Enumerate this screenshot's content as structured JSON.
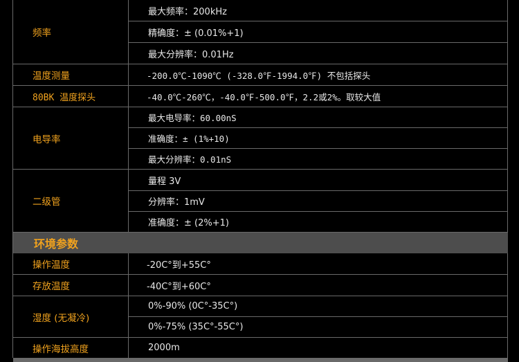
{
  "specs": {
    "frequency": {
      "label": "频率",
      "items": [
        "最大频率：200kHz",
        "精确度：± (0.01%+1)",
        "最大分辨率：0.01Hz"
      ]
    },
    "temperature": {
      "label": "温度测量",
      "value": "-200.0℃-1090℃ (-328.0℉-1994.0℉) 不包括探头"
    },
    "probe_80bk": {
      "label": "80BK 温度探头",
      "value": "-40.0℃-260℃，-40.0℉-500.0℉，2.2或2%。取较大值"
    },
    "conductivity": {
      "label": "电导率",
      "items": [
        "最大电导率：60.00nS",
        "准确度：± (1%+10)",
        "最大分辨率：0.01nS"
      ]
    },
    "diode": {
      "label": "二级管",
      "items": [
        "量程 3V",
        "分辨率：1mV",
        "准确度：± (2%+1)"
      ]
    }
  },
  "environment": {
    "section_title": "环境参数",
    "operating_temp": {
      "label": "操作温度",
      "value": "-20C°到+55C°"
    },
    "storage_temp": {
      "label": "存放温度",
      "value": "-40C°到+60C°"
    },
    "humidity": {
      "label": "湿度 (无凝冷)",
      "items": [
        "0%-90% (0C°-35C°)",
        "0%-75% (35C°-55C°)"
      ]
    },
    "altitude": {
      "label": "操作海拔高度",
      "value": "2000m"
    }
  }
}
